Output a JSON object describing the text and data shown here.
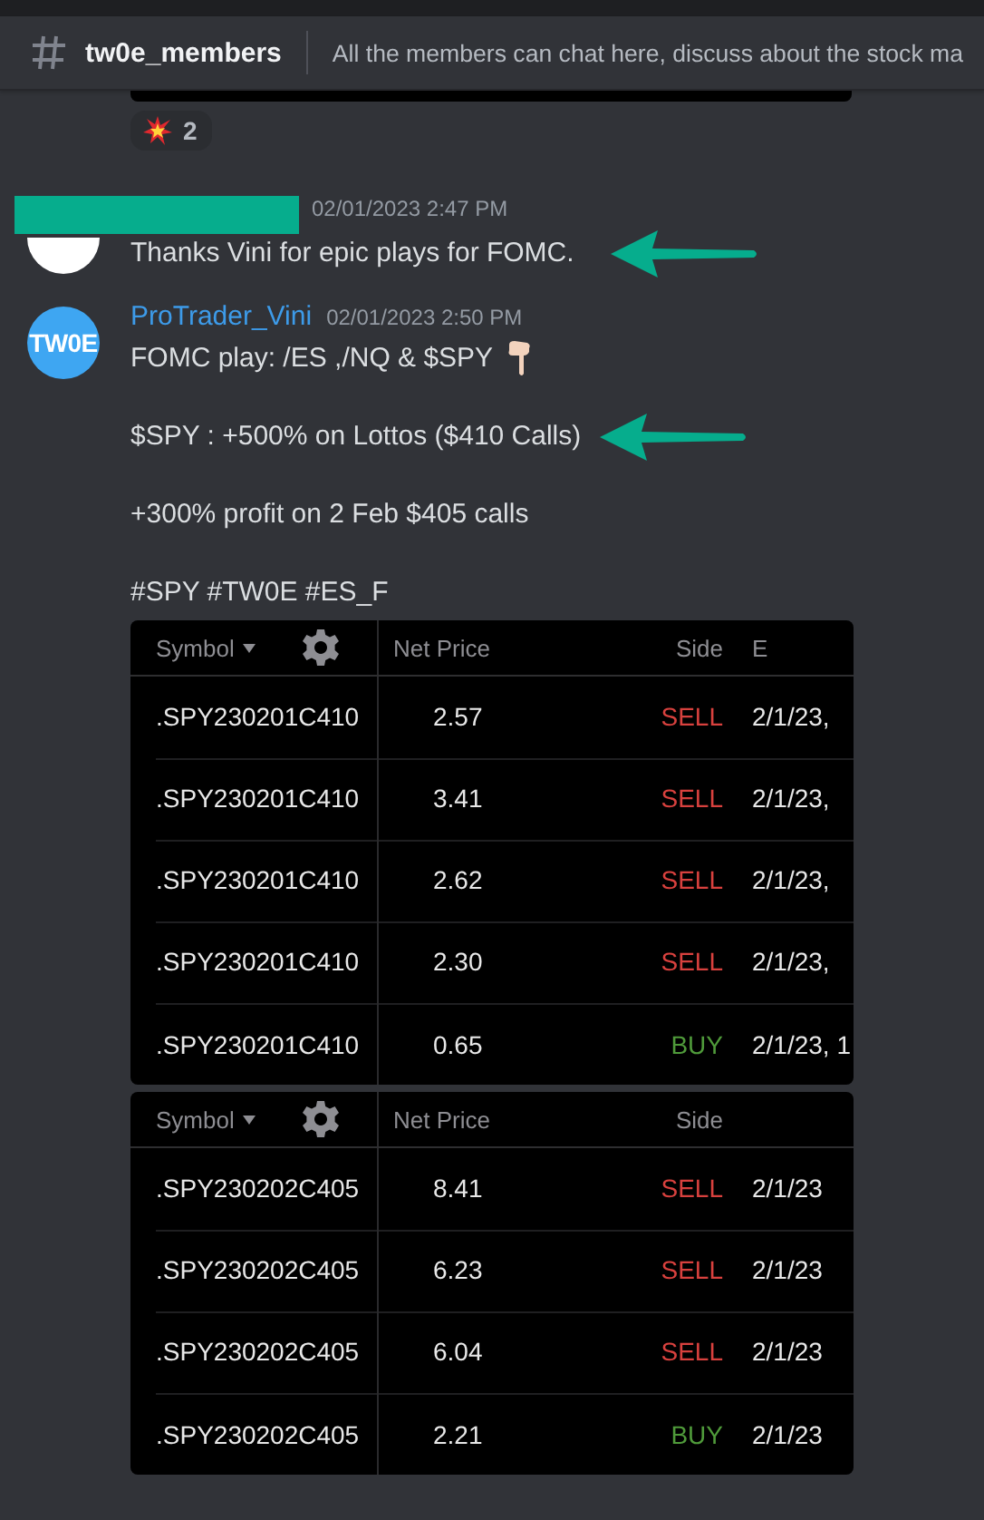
{
  "channel": {
    "name": "tw0e_members",
    "topic": "All the members can chat here, discuss about the stock ma"
  },
  "reactions": [
    {
      "count": "2"
    }
  ],
  "messages": [
    {
      "author_redacted": true,
      "timestamp": "02/01/2023 2:47 PM",
      "lines": [
        {
          "text": "Thanks Vini for epic plays for FOMC.",
          "arrow": true,
          "trailing_icon": false
        }
      ]
    },
    {
      "author": "ProTrader_Vini",
      "avatar_text": "TW0E",
      "timestamp": "02/01/2023 2:50 PM",
      "lines": [
        {
          "text": "FOMC play: /ES ,/NQ & $SPY",
          "arrow": false,
          "trailing_icon": true
        },
        {
          "text": "$SPY : +500% on Lottos ($410 Calls)",
          "arrow": true,
          "trailing_icon": false
        },
        {
          "text": "+300% profit on 2 Feb $405 calls",
          "arrow": false,
          "trailing_icon": false
        },
        {
          "text": "#SPY #TW0E #ES_F",
          "arrow": false,
          "trailing_icon": false
        }
      ],
      "attachments": [
        {
          "columns": [
            "Symbol",
            "Net Price",
            "Side",
            "E"
          ],
          "rows": [
            {
              "symbol": ".SPY230201C410",
              "net_price": "2.57",
              "side": "SELL",
              "color": "#d8413e",
              "time": "2/1/23,"
            },
            {
              "symbol": ".SPY230201C410",
              "net_price": "3.41",
              "side": "SELL",
              "color": "#d8413e",
              "time": "2/1/23,"
            },
            {
              "symbol": ".SPY230201C410",
              "net_price": "2.62",
              "side": "SELL",
              "color": "#d8413e",
              "time": "2/1/23,"
            },
            {
              "symbol": ".SPY230201C410",
              "net_price": "2.30",
              "side": "SELL",
              "color": "#d8413e",
              "time": "2/1/23,"
            },
            {
              "symbol": ".SPY230201C410",
              "net_price": "0.65",
              "side": "BUY",
              "color": "#4f9a3a",
              "time": "2/1/23, 1"
            }
          ]
        },
        {
          "columns": [
            "Symbol",
            "Net Price",
            "Side"
          ],
          "rows": [
            {
              "symbol": ".SPY230202C405",
              "net_price": "8.41",
              "side": "SELL",
              "color": "#d8413e",
              "time": "2/1/23"
            },
            {
              "symbol": ".SPY230202C405",
              "net_price": "6.23",
              "side": "SELL",
              "color": "#d8413e",
              "time": "2/1/23"
            },
            {
              "symbol": ".SPY230202C405",
              "net_price": "6.04",
              "side": "SELL",
              "color": "#d8413e",
              "time": "2/1/23"
            },
            {
              "symbol": ".SPY230202C405",
              "net_price": "2.21",
              "side": "BUY",
              "color": "#4f9a3a",
              "time": "2/1/23"
            }
          ]
        }
      ]
    }
  ]
}
